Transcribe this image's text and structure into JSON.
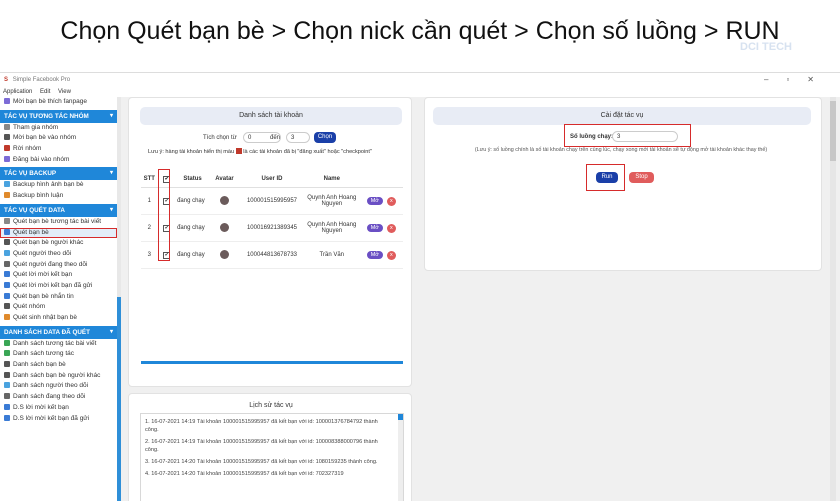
{
  "banner": {
    "text": "Chọn Quét bạn bè > Chọn nick cần quét > Chọn số luồng > RUN"
  },
  "watermark": "DCI TECH",
  "window": {
    "title": "Simple Facebook Pro",
    "controls": [
      "–",
      "▫",
      "✕"
    ]
  },
  "menu": [
    "Application",
    "Edit",
    "View"
  ],
  "sidebar": {
    "top_items": [
      {
        "label": "Mời bạn bè thích fanpage",
        "icon": "invite-icon",
        "color": "#7c6bd6"
      }
    ],
    "sections": [
      {
        "title": "TÁC VỤ TƯƠNG TÁC NHÓM",
        "items": [
          {
            "label": "Tham gia nhóm",
            "icon": "plus-icon",
            "color": "#888"
          },
          {
            "label": "Mời bạn bè vào nhóm",
            "icon": "group-icon",
            "color": "#555"
          },
          {
            "label": "Rời nhóm",
            "icon": "exit-icon",
            "color": "#c0392b"
          },
          {
            "label": "Đăng bài vào nhóm",
            "icon": "post-icon",
            "color": "#7c6bd6"
          }
        ]
      },
      {
        "title": "TÁC VỤ BACKUP",
        "items": [
          {
            "label": "Backup hình ảnh bạn bè",
            "icon": "image-icon",
            "color": "#4aa3df"
          },
          {
            "label": "Backup bình luận",
            "icon": "comment-icon",
            "color": "#e08a2c"
          }
        ]
      },
      {
        "title": "TÁC VỤ QUÉT DATA",
        "items": [
          {
            "label": "Quét bạn bè tương tác bài viết",
            "icon": "scan-icon",
            "color": "#888"
          },
          {
            "label": "Quét bạn bè",
            "icon": "friends-icon",
            "color": "#3a7bd5",
            "selected": true
          },
          {
            "label": "Quét bạn bè người khác",
            "icon": "friends-icon",
            "color": "#555"
          },
          {
            "label": "Quét người theo dõi",
            "icon": "follow-icon",
            "color": "#4aa3df"
          },
          {
            "label": "Quét người đang theo dõi",
            "icon": "follow-icon",
            "color": "#666"
          },
          {
            "label": "Quét lời mời kết bạn",
            "icon": "request-icon",
            "color": "#3a7bd5"
          },
          {
            "label": "Quét lời mời kết bạn đã gửi",
            "icon": "sent-icon",
            "color": "#3a7bd5"
          },
          {
            "label": "Quét bạn bè nhắn tin",
            "icon": "message-icon",
            "color": "#3a7bd5"
          },
          {
            "label": "Quét nhóm",
            "icon": "group-icon",
            "color": "#555"
          },
          {
            "label": "Quét sinh nhật bạn bè",
            "icon": "birthday-icon",
            "color": "#e08a2c"
          }
        ]
      },
      {
        "title": "DANH SÁCH DATA ĐÃ QUÉT",
        "items": [
          {
            "label": "Danh sách tương tác bài viết",
            "icon": "list-icon",
            "color": "#3aa655"
          },
          {
            "label": "Danh sách tương tác",
            "icon": "list-icon",
            "color": "#3aa655"
          },
          {
            "label": "Danh sách bạn bè",
            "icon": "friends-icon",
            "color": "#555"
          },
          {
            "label": "Danh sách bạn bè người khác",
            "icon": "friends-icon",
            "color": "#555"
          },
          {
            "label": "Danh sách người theo dõi",
            "icon": "follow-icon",
            "color": "#4aa3df"
          },
          {
            "label": "Danh sách đang theo dõi",
            "icon": "follow-icon",
            "color": "#666"
          },
          {
            "label": "D.S lời mời kết bạn",
            "icon": "request-icon",
            "color": "#3a7bd5"
          },
          {
            "label": "D.S lời mời kết bạn đã gửi",
            "icon": "sent-icon",
            "color": "#3a7bd5"
          }
        ]
      }
    ]
  },
  "accounts": {
    "title": "Danh sách tài khoản",
    "select_from_label": "Tích chọn từ",
    "from_value": "0",
    "to_label": "đến",
    "to_value": "3",
    "select_button": "Chọn",
    "note_prefix": "Lưu ý: hàng tài khoản hiển thị màu",
    "note_suffix": "là các tài khoản đã bị \"đăng xuất\" hoặc \"checkpoint\"",
    "columns": [
      "STT",
      "✔",
      "Status",
      "Avatar",
      "User ID",
      "Name"
    ],
    "rows": [
      {
        "stt": "1",
        "status": "đang chạy",
        "uid": "100001515995957",
        "name": "Quynh Anh Hoang Nguyen",
        "open": "Mở",
        "remove": "x"
      },
      {
        "stt": "2",
        "status": "đang chạy",
        "uid": "100016921389345",
        "name": "Quynh Anh Hoang Nguyen",
        "open": "Mở",
        "remove": "x"
      },
      {
        "stt": "3",
        "status": "đang chạy",
        "uid": "100044813678733",
        "name": "Trần Văn",
        "open": "Mở",
        "remove": "x"
      }
    ]
  },
  "settings": {
    "title": "Cài đặt tác vụ",
    "threads_label": "Số luồng chạy:",
    "threads_value": "3",
    "note": "(Lưu ý: số luồng chính là số tài khoản chạy trên cùng lúc, chạy xong mới tài khoản sẽ tự động mở tài khoản khác thay thế)",
    "run_button": "Run",
    "stop_button": "Stop"
  },
  "history": {
    "title": "Lịch sử tác vụ",
    "entries": [
      "1. 16-07-2021 14:19 Tài khoản 100001515995957 đã kết bạn với id: 100001376784792 thành công.",
      "2. 16-07-2021 14:19 Tài khoản 100001515995957 đã kết bạn với id: 100008388000796 thành công.",
      "3. 16-07-2021 14:20 Tài khoản 100001515995957 đã kết bạn với id: 1080159235 thành công.",
      "4. 16-07-2021 14:20 Tài khoản 100001515995957 đã kết bạn với id: 702327319"
    ]
  },
  "colors": {
    "accent": "#1f87d9",
    "run": "#1a3fa8",
    "stop": "#e05c5c",
    "open": "#6a4fc4",
    "highlight": "#d62b2b"
  }
}
